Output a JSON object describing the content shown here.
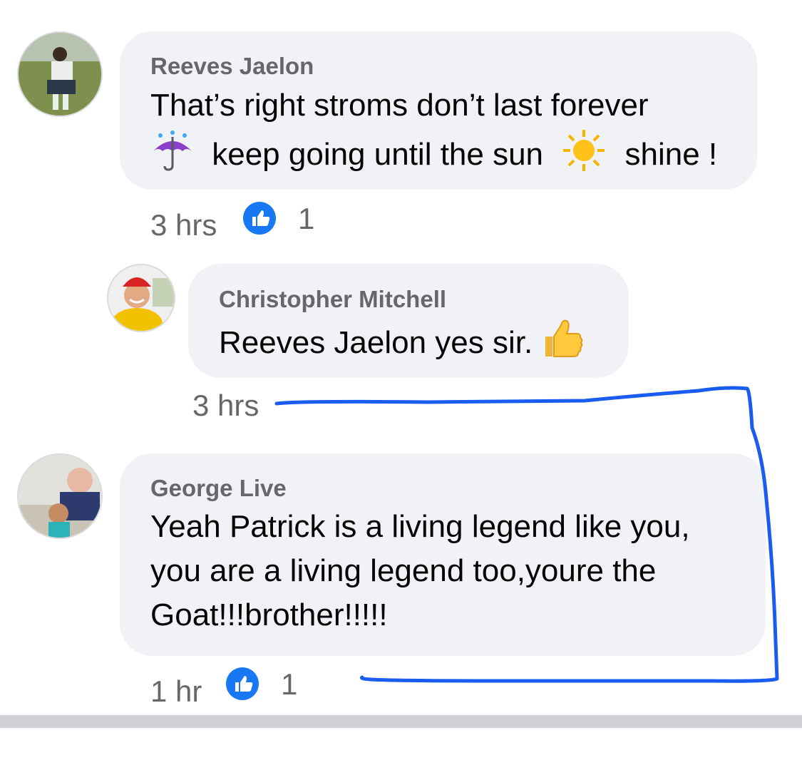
{
  "comments": [
    {
      "author": "Reeves Jaelon",
      "text_line1": "That’s right stroms don’t last forever",
      "text_line2_part1": "keep going until the sun",
      "text_line2_part2": "shine !",
      "emoji_umbrella": "umbrella-with-rain-emoji",
      "emoji_sun": "sun-emoji",
      "time": "3 hrs",
      "like_count": "1"
    },
    {
      "author": "Christopher Mitchell",
      "text": "Reeves Jaelon yes sir.",
      "emoji_thumb": "thumbs-up-emoji",
      "time": "3 hrs"
    },
    {
      "author": "George Live",
      "text_lines": [
        "Yeah Patrick is a living legend like you,",
        "you are a living legend too,youre the",
        "Goat!!!brother!!!!!"
      ],
      "time": "1 hr",
      "like_count": "1"
    }
  ],
  "colors": {
    "bubble": "#f0f2f5",
    "author": "#65676b",
    "text": "#050505",
    "like_blue": "#1877f2",
    "annotation": "#1a5cf0"
  }
}
